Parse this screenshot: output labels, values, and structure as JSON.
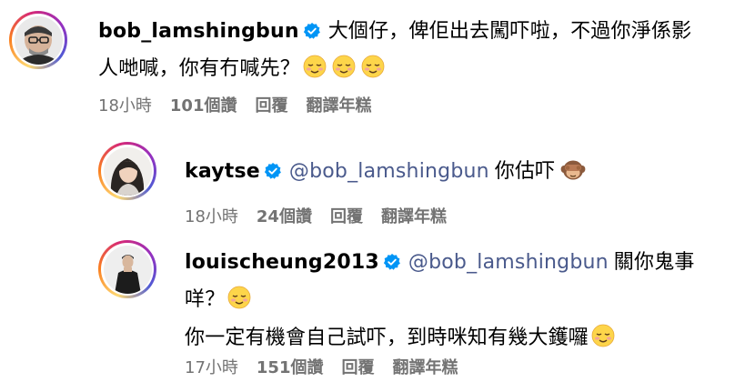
{
  "comments": [
    {
      "username": "bob_lamshingbun",
      "verified": true,
      "mention": "",
      "text_lines": [
        "大個仔，俾佢出去闖吓啦，不過你淨係影",
        "人哋喊，你有冇喊先？"
      ],
      "emojis": [
        "relieved-face",
        "relieved-face",
        "relieved-face"
      ],
      "time": "18小時",
      "likes": "101個讚",
      "reply": "回覆",
      "translate": "翻譯年糕"
    },
    {
      "username": "kaytse",
      "verified": true,
      "mention": "@bob_lamshingbun",
      "text": "你估吓",
      "emojis": [
        "see-no-evil-monkey"
      ],
      "time": "18小時",
      "likes": "24個讚",
      "reply": "回覆",
      "translate": "翻譯年糕"
    },
    {
      "username": "louischeung2013",
      "verified": true,
      "mention": "@bob_lamshingbun",
      "text_lines": [
        "關你鬼事",
        "咩？",
        "你一定有機會自己試吓，到時咪知有幾大鑊囉"
      ],
      "emojis": [
        "relieved-face",
        "relieved-face"
      ],
      "time": "17小時",
      "likes": "151個讚",
      "reply": "回覆",
      "translate": "翻譯年糕"
    }
  ],
  "colors": {
    "verified_badge": "#0095f6",
    "mention": "#4a5a8c",
    "meta_text": "#737373"
  }
}
